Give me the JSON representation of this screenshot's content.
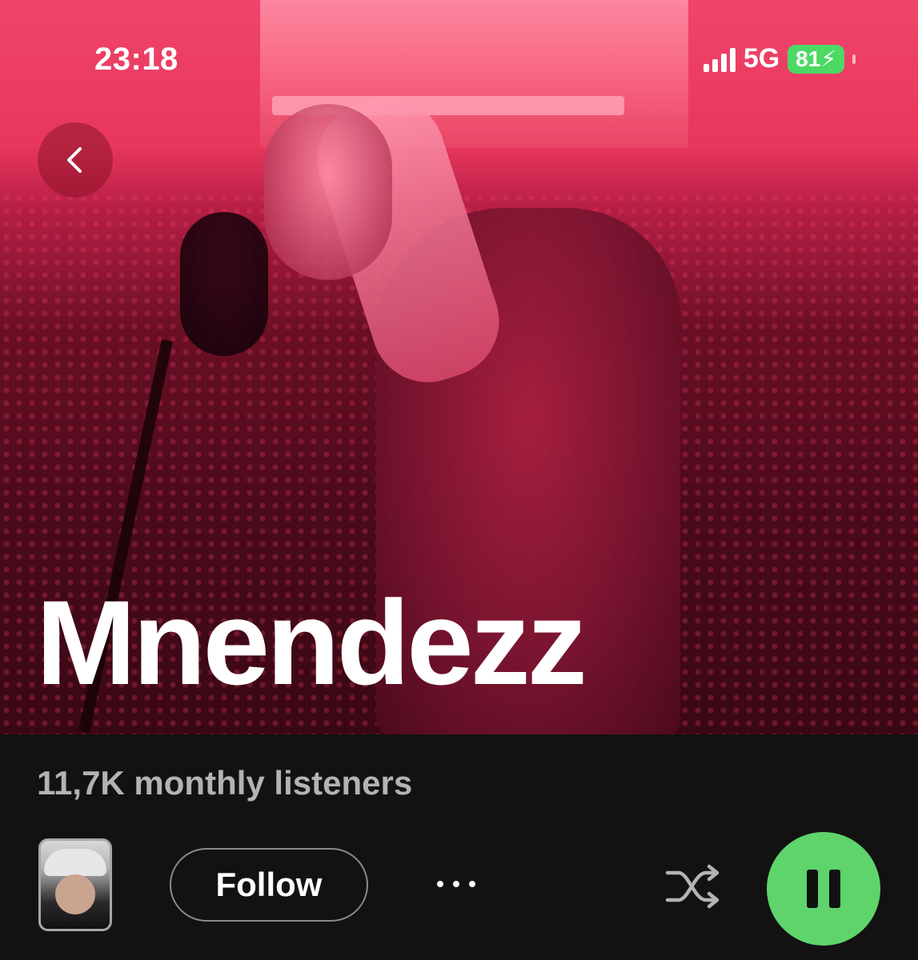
{
  "status_bar": {
    "time": "23:18",
    "network": "5G",
    "battery": "81",
    "battery_color": "#4cd964"
  },
  "header": {
    "back_icon": "chevron-left-icon"
  },
  "artist": {
    "name": "Mnendezz",
    "monthly_listeners": "11,7K monthly listeners"
  },
  "actions": {
    "follow_label": "Follow",
    "more_icon": "more-horizontal-icon",
    "shuffle_icon": "shuffle-icon",
    "pause_icon": "pause-icon",
    "play_button_color": "#5ed46b"
  }
}
